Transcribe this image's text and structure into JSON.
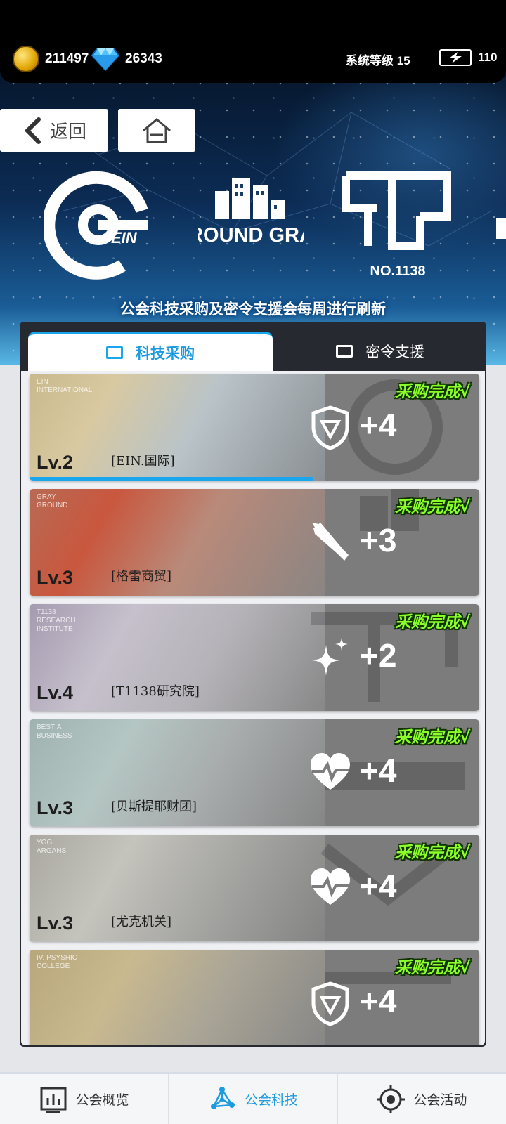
{
  "status": {
    "gold_icon": "gold-coin-icon",
    "gold": "211497",
    "diamond_icon": "diamond-icon",
    "diamonds": "26343",
    "system_level": "系统等级 15",
    "stamina_icon": "energy-battery-icon",
    "stamina": "110"
  },
  "nav": {
    "back_label": "返回",
    "home_icon": "home-icon"
  },
  "banner": {
    "logos": [
      "EIN",
      "GROUND GRAY.",
      "NO.1138"
    ],
    "notice": "公会科技采购及密令支援会每周进行刷新"
  },
  "tabs": [
    {
      "label": "科技采购",
      "active": true
    },
    {
      "label": "密令支援",
      "active": false
    }
  ],
  "done_label": "采购完成√",
  "cards": [
    {
      "tag": "EIN\nINTERNATIONAL",
      "level": "Lv.2",
      "name": "[EIN.国际]",
      "bonus": "+4",
      "icon": "shield-icon",
      "progress": 0.63
    },
    {
      "tag": "GRAY\nGROUND",
      "level": "Lv.3",
      "name": "[格雷商贸]",
      "bonus": "+3",
      "icon": "weapon-icon"
    },
    {
      "tag": "T1138\nRESEARCH\nINSTITUTE",
      "level": "Lv.4",
      "name": "[T1138研究院]",
      "bonus": "+2",
      "icon": "sparkle-icon"
    },
    {
      "tag": "BESTIA\nBUSINESS",
      "level": "Lv.3",
      "name": "[贝斯提耶财团]",
      "bonus": "+4",
      "icon": "heartbeat-icon"
    },
    {
      "tag": "YGG\nARGANS",
      "level": "Lv.3",
      "name": "[尤克机关]",
      "bonus": "+4",
      "icon": "heartbeat-icon"
    },
    {
      "tag": "IV. PSYSHIC\nCOLLEGE",
      "level": "",
      "name": "",
      "bonus": "+4",
      "icon": "shield-icon"
    }
  ],
  "bottom_nav": [
    {
      "label": "公会概览",
      "icon": "chart-icon",
      "active": false
    },
    {
      "label": "公会科技",
      "icon": "network-icon",
      "active": true
    },
    {
      "label": "公会活动",
      "icon": "target-icon",
      "active": false
    }
  ],
  "colors": {
    "accent": "#1aa6ec",
    "done_green": "#8bff2a",
    "card_gray": "#7c7c7c"
  }
}
